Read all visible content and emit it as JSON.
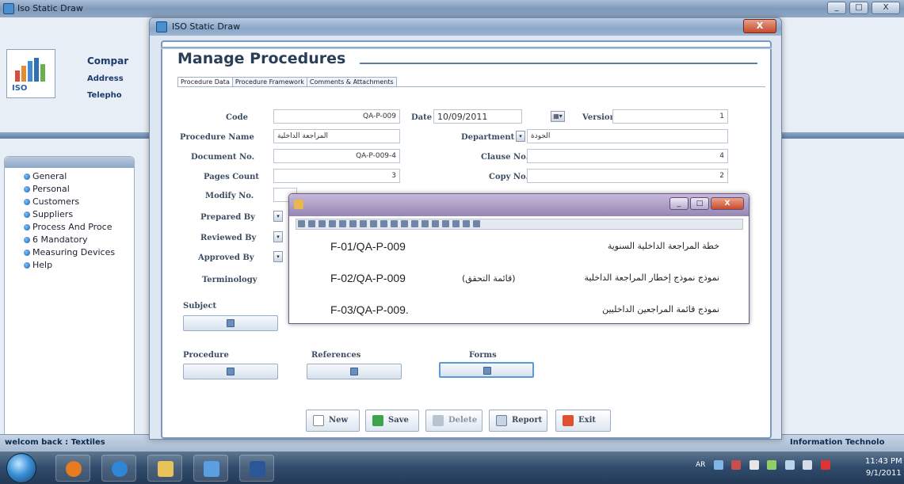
{
  "back_window": {
    "title": "Iso Static Draw",
    "company": "Compar",
    "address_label": "Address",
    "telephone_label": "Telepho",
    "logo_text": "ISO",
    "menu": [
      {
        "label": "General"
      },
      {
        "label": "Personal"
      },
      {
        "label": "Customers"
      },
      {
        "label": "Suppliers"
      },
      {
        "label": "Process And Proce"
      },
      {
        "label": "6 Mandatory"
      },
      {
        "label": "Measuring Devices"
      },
      {
        "label": "Help"
      }
    ],
    "status_left": "welcom back : Textiles",
    "status_right": "Information Technolo",
    "controls": {
      "min": "_",
      "max": "□",
      "close": "X"
    }
  },
  "window": {
    "title": "ISO Static Draw",
    "close_glyph": "X",
    "heading": "Manage Procedures",
    "tabs": [
      {
        "label": "Procedure Data"
      },
      {
        "label": "Procedure Framework"
      },
      {
        "label": "Comments & Attachments"
      }
    ]
  },
  "form": {
    "code_label": "Code",
    "code_value": "QA-P-009",
    "date_label": "Date",
    "date_value": "10/09/2011",
    "version_label": "Version",
    "version_value": "1",
    "procedure_name_label": "Procedure Name",
    "procedure_name_value": "المراجعة الداخلية",
    "department_label": "Department",
    "department_value": "الجودة",
    "document_no_label": "Document No.",
    "document_no_value": "QA-P-009-4",
    "clause_no_label": "Clause No.",
    "clause_no_value": "4",
    "pages_count_label": "Pages Count",
    "pages_count_value": "3",
    "copy_no_label": "Copy No.",
    "copy_no_value": "2",
    "modify_no_label": "Modify No.",
    "prepared_by_label": "Prepared By",
    "reviewed_by_label": "Reviewed By",
    "approved_by_label": "Approved By",
    "terminology_label": "Terminology",
    "subject_label": "Subject",
    "procedure_label": "Procedure",
    "references_label": "References",
    "forms_label": "Forms",
    "dropdown_glyph": "▾",
    "picker_glyph": "▦▾"
  },
  "actions": {
    "new": "New",
    "save": "Save",
    "delete": "Delete",
    "report": "Report",
    "exit": "Exit"
  },
  "popup": {
    "rows": [
      {
        "code": "F-01/QA-P-009",
        "name": "خطة المراجعة الداخلية السنوية",
        "extra": ""
      },
      {
        "code": "F-02/QA-P-009",
        "name": "نموذج نموذج إخطار المراجعة الداخلية",
        "extra": "(قائمة التحقق)"
      },
      {
        "code": "F-03/QA-P-009.",
        "name": "نموذج قائمة المراجعين الداخليين",
        "extra": ""
      }
    ],
    "controls": {
      "min": "_",
      "max": "□",
      "close": "X"
    }
  },
  "taskbar": {
    "lang": "AR",
    "clock_time": "11:43 PM",
    "clock_date": "9/1/2011"
  },
  "colors": {
    "accent": "#2a3e57",
    "frame": "#7a98c0",
    "popup_title": "#9686b5"
  }
}
